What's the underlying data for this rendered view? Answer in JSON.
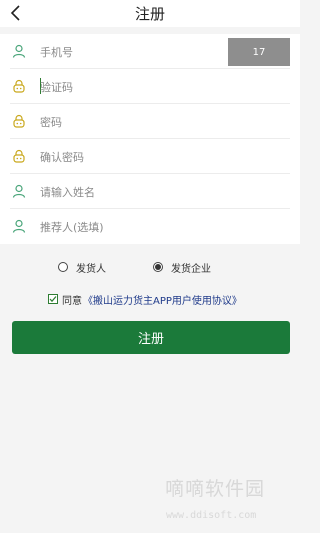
{
  "header": {
    "title": "注册",
    "back_icon": "chevron-left-icon"
  },
  "form": {
    "fields": [
      {
        "placeholder": "手机号",
        "value": "",
        "icon": "user-icon"
      },
      {
        "placeholder": "验证码",
        "value": "",
        "icon": "lock-icon"
      },
      {
        "placeholder": "密码",
        "value": "",
        "icon": "lock-icon"
      },
      {
        "placeholder": "确认密码",
        "value": "",
        "icon": "lock-icon"
      },
      {
        "placeholder": "请输入姓名",
        "value": "",
        "icon": "user-icon"
      },
      {
        "placeholder": "推荐人(选填)",
        "value": "",
        "icon": "user-icon"
      }
    ],
    "code_button_label": "17"
  },
  "roles": {
    "options": [
      "发货人",
      "发货企业"
    ],
    "selected": "发货企业"
  },
  "agreement": {
    "checked": true,
    "prefix": "同意",
    "link": "《搬山运力货主APP用户使用协议》"
  },
  "submit_label": "注册",
  "watermark": {
    "text": "嘀嘀软件园",
    "url": "www.ddisoft.com"
  },
  "colors": {
    "accent": "#1b7a3a",
    "icon_green": "#4aa57a",
    "icon_yellow": "#c9a81c",
    "link": "#1f3a8a"
  }
}
